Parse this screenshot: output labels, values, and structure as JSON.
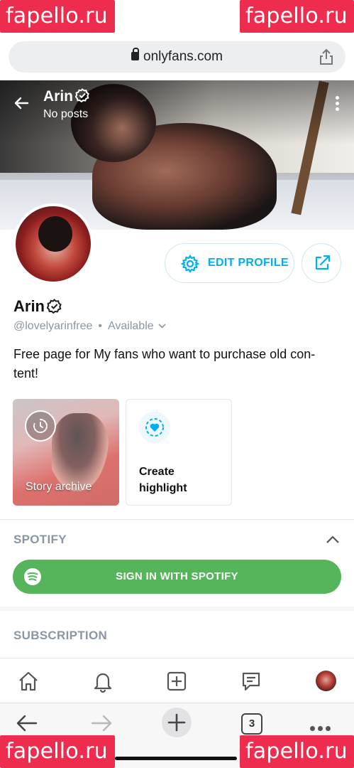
{
  "status_bar": {
    "time": "·.·•·· ·!",
    "icons": "·.·•·· ·!"
  },
  "url_bar": {
    "url": "onlyfans.com"
  },
  "banner": {
    "name": "Arin",
    "subtitle": "No posts"
  },
  "profile": {
    "name": "Arin",
    "handle": "@lovelyarinfree",
    "separator": "•",
    "availability": "Available",
    "bio": "Free page for My fans who want to purchase old con- tent!"
  },
  "actions": {
    "edit_profile_label": "EDIT PROFILE"
  },
  "highlights": [
    {
      "label": "Story archive"
    },
    {
      "label": "Create highlight"
    }
  ],
  "sections": {
    "spotify_title": "SPOTIFY",
    "spotify_button": "SIGN IN WITH SPOTIFY",
    "subscription_title": "SUBSCRIPTION"
  },
  "browser": {
    "tab_count": "3"
  },
  "watermarks": [
    "fapello.ru",
    "fapello.ru",
    "fapello.ru",
    "fapello.ru"
  ],
  "colors": {
    "accent": "#00aff0",
    "spotify": "#56b45a",
    "watermark": "#ee2d4e",
    "muted": "#8a96a3"
  },
  "icons": [
    "lock-icon",
    "share-icon",
    "back-arrow-icon",
    "verified-icon",
    "kebab-icon",
    "gear-icon",
    "share-out-icon",
    "chevron-down-icon",
    "clock-icon",
    "heart-circle-icon",
    "chevron-up-icon",
    "spotify-icon",
    "home-icon",
    "bell-icon",
    "add-post-icon",
    "messages-icon",
    "nav-back-icon",
    "nav-forward-icon",
    "new-tab-icon",
    "more-icon"
  ]
}
